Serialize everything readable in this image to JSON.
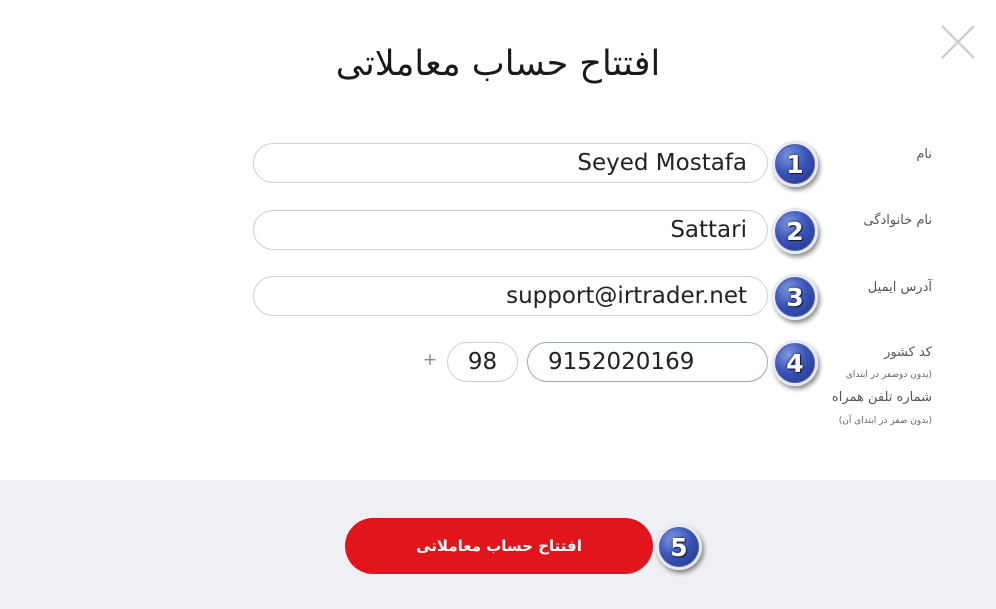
{
  "dialog": {
    "title": "افتتاح حساب معاملاتی"
  },
  "fields": {
    "first_name": {
      "label": "نام",
      "value": "Seyed Mostafa",
      "step": "1"
    },
    "last_name": {
      "label": "نام خانوادگی",
      "value": "Sattari",
      "step": "2"
    },
    "email": {
      "label": "آدرس ایمیل",
      "value": "support@irtrader.net",
      "step": "3"
    },
    "phone": {
      "country_code_label": "کد کشور",
      "country_code_hint": "(بدون دوصفر در ابتدای",
      "phone_label": "شماره تلفن همراه",
      "phone_hint": "(بدون صفر در ابتدای آن)",
      "plus_sign": "+",
      "country_code": "98",
      "number": "9152020169",
      "step": "4"
    }
  },
  "footer": {
    "submit_label": "افتتاح حساب معاملاتی",
    "step": "5"
  },
  "colors": {
    "submit_bg": "#e2141c",
    "footer_bg": "#eef0f3",
    "badge": "#3b55b8"
  },
  "icons": {
    "close": "close-icon"
  }
}
